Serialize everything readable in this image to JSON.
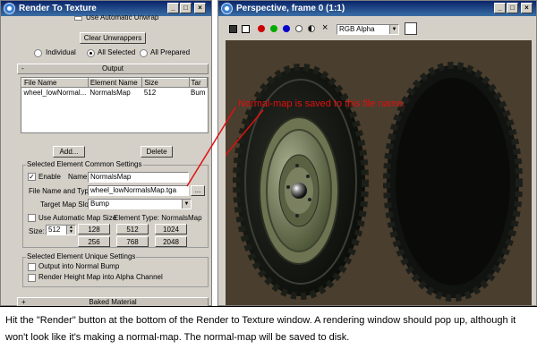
{
  "rtt_window": {
    "title": "Render To Texture",
    "partial_option": "Use Automatic Unwrap",
    "clear_unwrappers": "Clear Unwrappers",
    "radios": [
      {
        "label": "Individual",
        "selected": false
      },
      {
        "label": "All Selected",
        "selected": true
      },
      {
        "label": "All Prepared",
        "selected": false
      }
    ],
    "output_rollout": "Output",
    "table": {
      "columns": [
        "File Name",
        "Element Name",
        "Size",
        "Tar"
      ],
      "rows": [
        [
          "wheel_lowNormal...",
          "NormalsMap",
          "512",
          "Bum"
        ]
      ]
    },
    "add_button": "Add...",
    "delete_button": "Delete",
    "common_group": "Selected Element Common Settings",
    "enable_label": "Enable",
    "enable_checked": true,
    "name_label": "Name:",
    "name_value": "NormalsMap",
    "file_label": "File Name and Type:",
    "file_value": "wheel_lowNormalsMap.tga",
    "browse_label": "...",
    "target_label": "Target Map Slot:",
    "target_value": "Bump",
    "auto_size_label": "Use Automatic Map Size",
    "element_type": "Element Type: NormalsMap",
    "size_label": "Size:",
    "size_value": "512",
    "size_buttons": [
      "128",
      "512",
      "1024",
      "256",
      "768",
      "2048"
    ],
    "unique_group": "Selected Element Unique Settings",
    "unique_options": [
      "Output into Normal Bump",
      "Render Height Map into Alpha Channel"
    ],
    "baked_rollout": "Baked Material"
  },
  "viewport_window": {
    "title": "Perspective, frame 0 (1:1)",
    "channel": "RGB Alpha",
    "channel_colors": [
      "#cc0000",
      "#00aa00",
      "#0000cc",
      "#ffffff"
    ]
  },
  "annotation": "Normal-map is saved to this file name.",
  "caption": "Hit the \"Render\" button at the bottom of the Render to Texture window. A rendering window should pop up, although it won't look like it's making a normal-map. The normal-map will be saved to disk."
}
